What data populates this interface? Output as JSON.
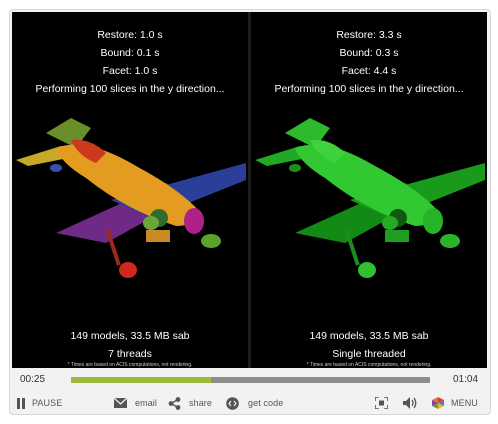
{
  "left_pane": {
    "restore": "Restore: 1.0 s",
    "bound": "Bound: 0.1 s",
    "facet": "Facet: 1.0 s",
    "performing": "Performing 100 slices in the y direction...",
    "models": "149 models, 33.5 MB sab",
    "threads": "7 threads",
    "note": "* Times are based on ACIS computations, not rendering."
  },
  "right_pane": {
    "restore": "Restore: 3.3 s",
    "bound": "Bound: 0.3 s",
    "facet": "Facet: 4.4 s",
    "performing": "Performing 100 slices in the y direction...",
    "models": "149 models, 33.5 MB sab",
    "threads": "Single threaded",
    "note": "* Times are based on ACIS computations, not rendering."
  },
  "controls": {
    "elapsed": "00:25",
    "duration": "01:04",
    "progress": 0.39,
    "pause_label": "PAUSE",
    "email_label": "email",
    "share_label": "share",
    "getcode_label": "get code",
    "menu_label": "MENU"
  },
  "colors": {
    "progress_fill": "#9dba3b",
    "track": "#8c8c8c",
    "plane_green": "#2ec12e"
  }
}
